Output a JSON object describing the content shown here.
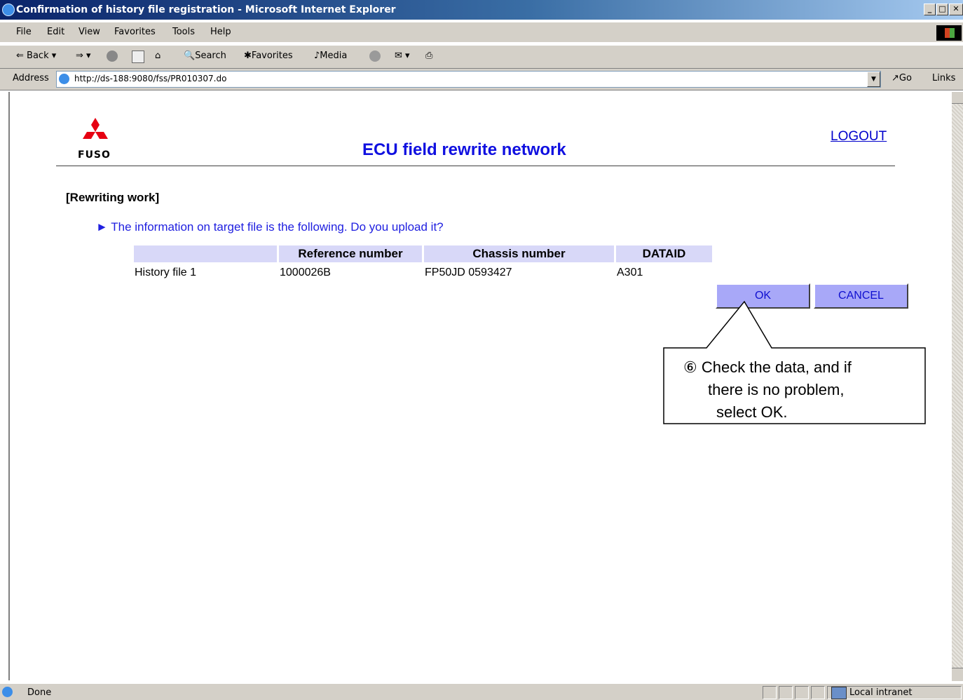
{
  "window": {
    "title": "Confirmation of history file registration - Microsoft Internet Explorer",
    "controls": [
      "_",
      "ƈ",
      "X"
    ]
  },
  "menu": {
    "items": [
      "File",
      "Edit",
      "View",
      "Favorites",
      "Tools",
      "Help"
    ]
  },
  "toolbar": {
    "back_label": "Back",
    "search_label": "Search",
    "favorites_label": "Favorites",
    "media_label": "Media"
  },
  "address": {
    "label": "Address",
    "url": "http://ds-188:9080/fss/PR010307.do",
    "go_label": "Go",
    "links_label": "Links"
  },
  "page": {
    "logo_text": "FUSO",
    "title": "ECU field rewrite network",
    "logout_label": "LOGOUT",
    "section_title": "[Rewriting work]",
    "prompt": "► The information on target file is the following. Do you upload it?",
    "table": {
      "headers": [
        "",
        "Reference number",
        "Chassis number",
        "DATAID"
      ],
      "rows": [
        [
          "History file 1",
          "1000026B",
          "FP50JD 0593427",
          "A301"
        ]
      ]
    },
    "ok_label": "OK",
    "cancel_label": "CANCEL",
    "callout": {
      "line1": "⑥ Check the data, and if",
      "line2": "there is no problem,",
      "line3": "select OK."
    }
  },
  "status": {
    "text": "Done",
    "zone": "Local intranet"
  }
}
